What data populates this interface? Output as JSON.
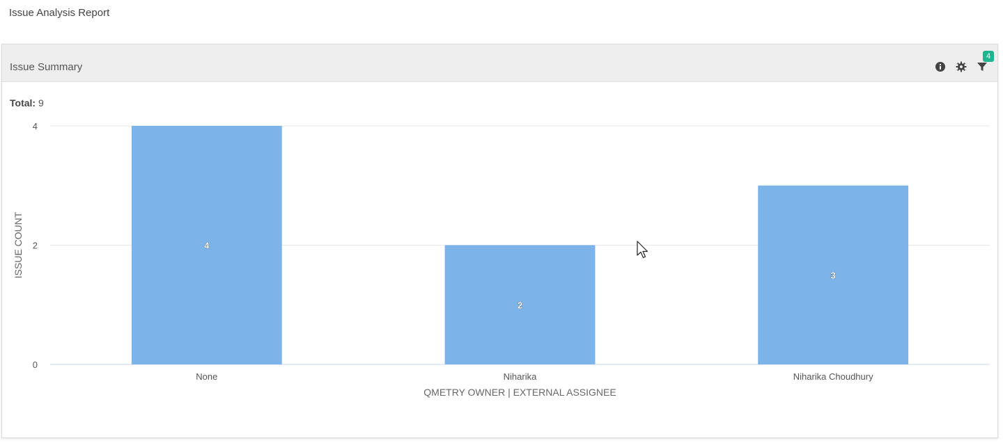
{
  "page": {
    "title": "Issue Analysis Report"
  },
  "panel": {
    "title": "Issue Summary",
    "filter_count": "4",
    "total_label": "Total:",
    "total_value": "9",
    "icons": [
      "info-icon",
      "gear-icon",
      "filter-icon"
    ]
  },
  "chart_data": {
    "type": "bar",
    "categories": [
      "None",
      "Niharika",
      "Niharika Choudhury"
    ],
    "values": [
      4,
      2,
      3
    ],
    "data_labels": [
      "4",
      "2",
      "3"
    ],
    "xlabel": "QMETRY OWNER | EXTERNAL ASSIGNEE",
    "ylabel": "ISSUE COUNT",
    "yticks": [
      0,
      2,
      4
    ],
    "ytick_labels": [
      "0",
      "2",
      "4"
    ],
    "ylim": [
      0,
      4
    ],
    "grid": true,
    "legend": "none",
    "bar_color": "#7cb4ea"
  }
}
